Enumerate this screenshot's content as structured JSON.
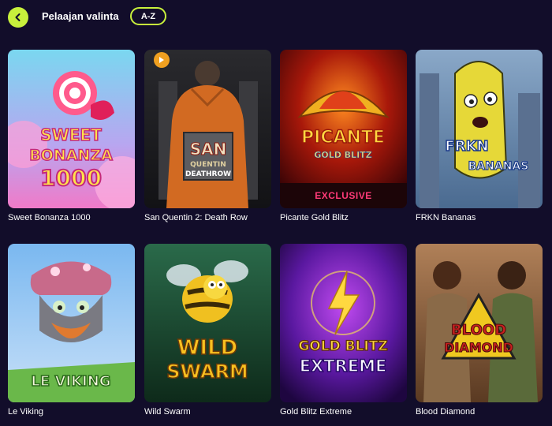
{
  "header": {
    "back_icon": "chevron-left-icon",
    "title": "Pelaajan valinta",
    "sort_label": "A-Z"
  },
  "colors": {
    "accent": "#c8f03c",
    "background": "#120d2a",
    "exclusive": "#ff3a78"
  },
  "games": [
    {
      "title": "Sweet Bonanza 1000",
      "logo_lines": [
        "SWEET",
        "BONANZA",
        "1000"
      ]
    },
    {
      "title": "San Quentin 2: Death Row",
      "logo_lines": [
        "SAN",
        "QUENTIN",
        "DEATHROW"
      ]
    },
    {
      "title": "Picante Gold Blitz",
      "logo_lines": [
        "PICANTE",
        "GOLD BLITZ"
      ],
      "badge": "EXCLUSIVE"
    },
    {
      "title": "FRKN Bananas",
      "logo_lines": [
        "FRKN",
        "BANANAS"
      ]
    },
    {
      "title": "Le Viking",
      "logo_lines": [
        "LE VIKING"
      ]
    },
    {
      "title": "Wild Swarm",
      "logo_lines": [
        "WILD",
        "SWARM"
      ]
    },
    {
      "title": "Gold Blitz Extreme",
      "logo_lines": [
        "GOLD BLITZ",
        "EXTREME"
      ]
    },
    {
      "title": "Blood Diamond",
      "logo_lines": [
        "BLOOD",
        "DIAMOND"
      ]
    }
  ]
}
